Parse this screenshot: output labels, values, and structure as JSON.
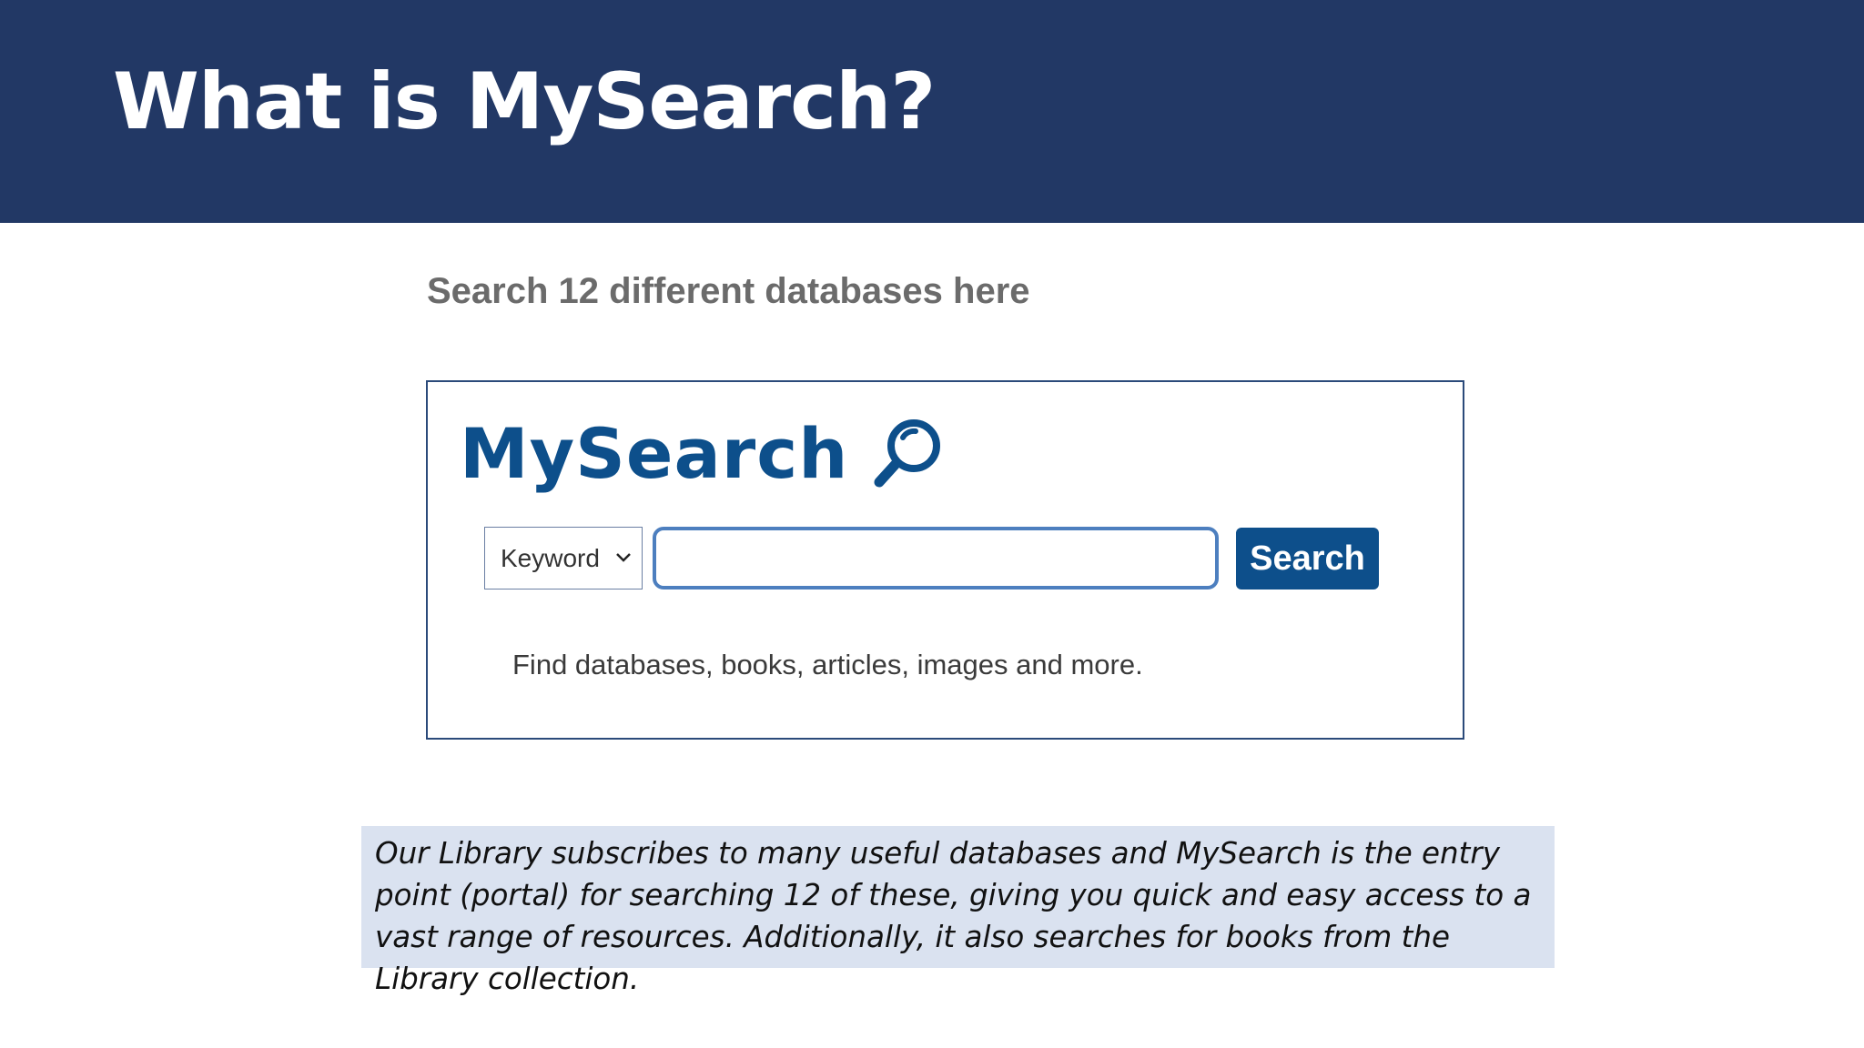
{
  "slide": {
    "title": "What is MySearch?",
    "subheading": "Search 12 different databases here",
    "note": "Our Library subscribes to many useful databases and MySearch is the entry point (portal) for searching 12 of these, giving you quick and easy access to a vast range of resources. Additionally, it also searches for books from the Library collection."
  },
  "widget": {
    "logo_text": "MySearch",
    "logo_icon": "magnifier-icon",
    "search_type": {
      "selected": "Keyword",
      "options": [
        "Keyword"
      ],
      "icon": "chevron-down-icon"
    },
    "search_input": {
      "value": "",
      "placeholder": ""
    },
    "search_button": "Search",
    "helper_text": "Find databases, books, articles, images and more."
  },
  "colors": {
    "header_bg": "#223865",
    "brand_blue": "#0d4f8b",
    "input_border": "#4d7fbf",
    "note_bg": "#dae2f0"
  }
}
